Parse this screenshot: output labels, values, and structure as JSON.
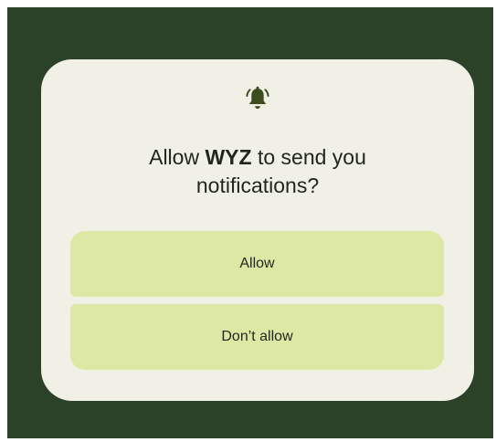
{
  "colors": {
    "background": "#2b4228",
    "dialog": "#f0f0e6",
    "button": "#dde8a4",
    "text": "#1f261e",
    "icon": "#3d4d1f"
  },
  "dialog": {
    "icon": "bell-ringing-icon",
    "title_prefix": "Allow ",
    "app_name": "WYZ",
    "title_suffix_line1": " to send you",
    "title_line2": "notifications?",
    "allow_label": "Allow",
    "deny_label": "Don’t allow"
  }
}
